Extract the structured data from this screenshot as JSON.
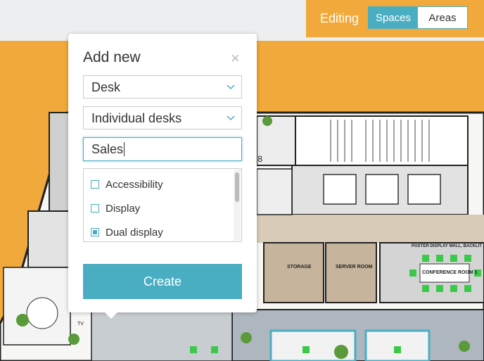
{
  "editing": {
    "label": "Editing",
    "tabs": [
      {
        "label": "Spaces",
        "active": true
      },
      {
        "label": "Areas",
        "active": false
      }
    ]
  },
  "modal": {
    "title": "Add new",
    "close_glyph": "×",
    "type_select": {
      "value": "Desk"
    },
    "subtype_select": {
      "value": "Individual desks"
    },
    "name_input": {
      "value": "Sales"
    },
    "amenities": [
      {
        "label": "Accessibility",
        "checked": false
      },
      {
        "label": "Display",
        "checked": false
      },
      {
        "label": "Dual display",
        "checked": true
      }
    ],
    "create_label": "Create"
  },
  "floorplan": {
    "labels": {
      "storage": "STORAGE",
      "server_room": "SERVER ROOM",
      "conference_room": "CONFERENCE ROOM 1",
      "poster_wall": "POSTER DISPLAY WALL, BACKLIT",
      "tv": "TV",
      "room_number": "/8"
    }
  },
  "colors": {
    "accent": "#4aaec3",
    "background_orange": "#f0a93a",
    "chair_green": "#3cc84a"
  }
}
